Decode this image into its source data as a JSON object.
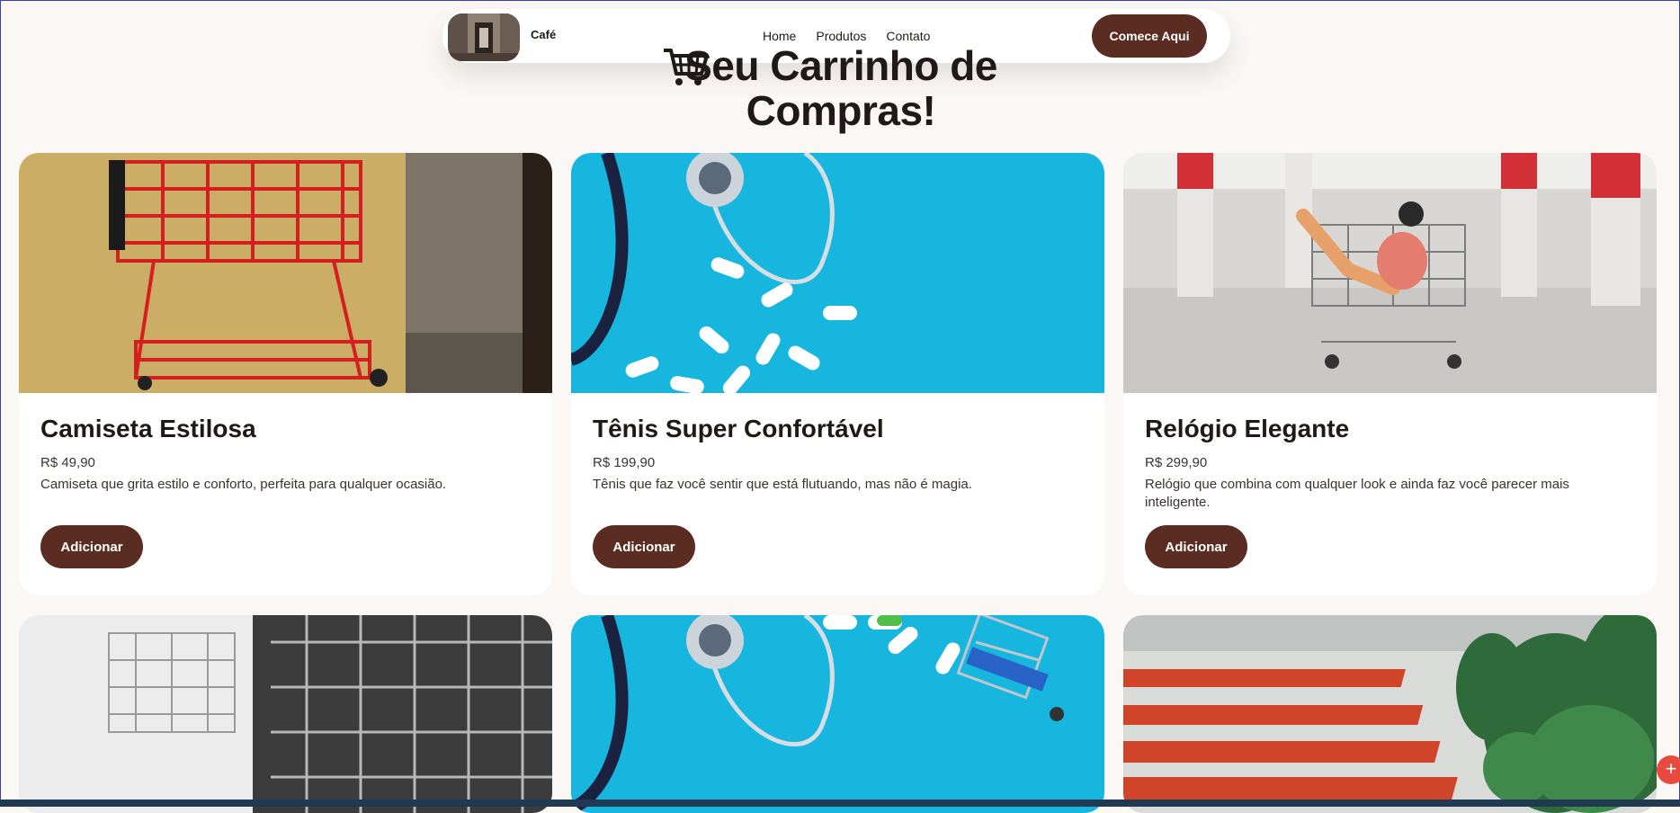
{
  "nav": {
    "brand": "Café",
    "links": [
      "Home",
      "Produtos",
      "Contato"
    ],
    "cta": "Comece Aqui"
  },
  "title": "Seu Carrinho de Compras!",
  "products": [
    {
      "name": "Camiseta Estilosa",
      "price": "R$ 49,90",
      "description": "Camiseta que grita estilo e conforto, perfeita para qualquer ocasião.",
      "button": "Adicionar"
    },
    {
      "name": "Tênis Super Confortável",
      "price": "R$ 199,90",
      "description": "Tênis que faz você sentir que está flutuando, mas não é magia.",
      "button": "Adicionar"
    },
    {
      "name": "Relógio Elegante",
      "price": "R$ 299,90",
      "description": "Relógio que combina com qualquer look e ainda faz você parecer mais inteligente.",
      "button": "Adicionar"
    }
  ],
  "icons": [
    "shopping-cart-icon",
    "plus-icon"
  ],
  "colors": {
    "accent": "#5a2c22",
    "background": "#fbf7f4",
    "fab": "#e84a3e"
  }
}
